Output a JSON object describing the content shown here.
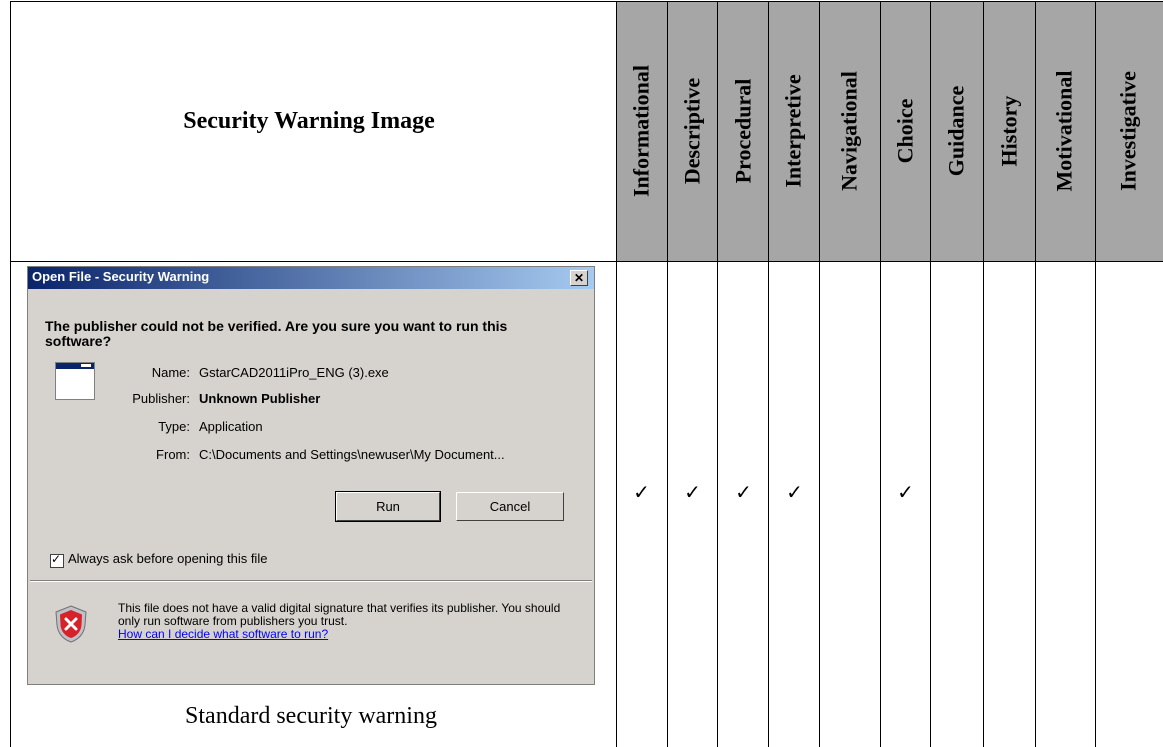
{
  "table": {
    "header_title": "Security Warning Image",
    "columns": [
      "Informational",
      "Descriptive",
      "Procedural",
      "Interpretive",
      "Navigational",
      "Choice",
      "Guidance",
      "History",
      "Motivational",
      "Investigative"
    ],
    "checks": [
      "✓",
      "✓",
      "✓",
      "✓",
      "",
      "✓",
      "",
      "",
      "",
      ""
    ],
    "caption": "Standard security warning"
  },
  "dialog": {
    "title": "Open File - Security Warning",
    "close_glyph": "✕",
    "question": "The publisher could not be verified.  Are you sure you want to run this software?",
    "name_label": "Name:",
    "name_value": "GstarCAD2011iPro_ENG (3).exe",
    "publisher_label": "Publisher:",
    "publisher_value": "Unknown Publisher",
    "type_label": "Type:",
    "type_value": "Application",
    "from_label": "From:",
    "from_value": "C:\\Documents and Settings\\newuser\\My Document...",
    "run_label": "Run",
    "cancel_label": "Cancel",
    "checkbox_label": "Always ask before opening this file",
    "checkbox_mark": "✓",
    "warning_text": "This file does not have a valid digital signature that verifies its publisher.  You should only run software from publishers you trust.",
    "warning_link": "How can I decide what software to run?",
    "icon": "shield-icon"
  }
}
